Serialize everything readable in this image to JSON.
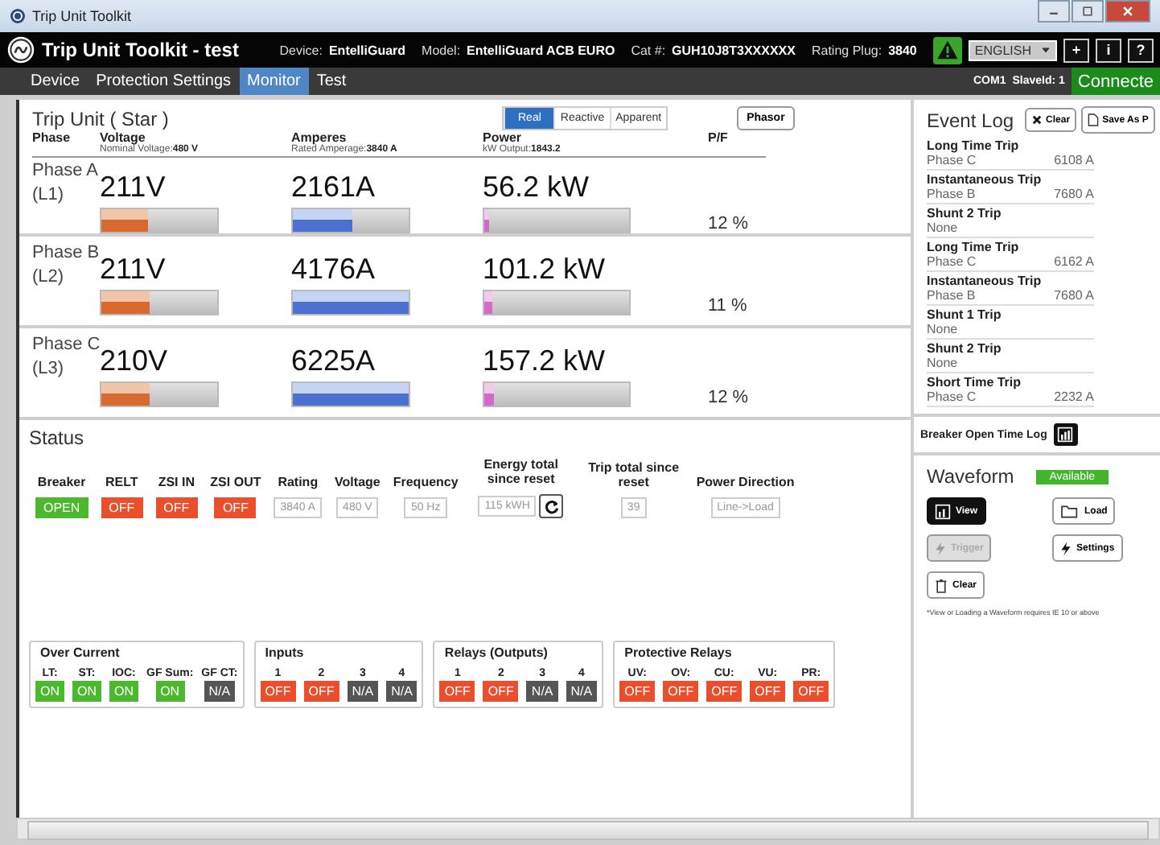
{
  "window": {
    "title": "Trip Unit Toolkit"
  },
  "header": {
    "app_title": "Trip Unit Toolkit -  test",
    "info": [
      {
        "label": "Device:",
        "value": "EntelliGuard"
      },
      {
        "label": "Model:",
        "value": "EntelliGuard ACB EURO"
      },
      {
        "label": "Cat #:",
        "value": "GUH10J8T3XXXXXX"
      },
      {
        "label": "Rating Plug:",
        "value": "3840"
      }
    ],
    "language": "ENGLISH",
    "buttons": [
      "+",
      "i",
      "?"
    ]
  },
  "nav": {
    "tabs": [
      {
        "label": "Device",
        "selected": false
      },
      {
        "label": "Protection Settings",
        "selected": false
      },
      {
        "label": "Monitor",
        "selected": true
      },
      {
        "label": "Test",
        "selected": false
      }
    ],
    "port": "COM1",
    "slave": "SlaveId: 1",
    "connection": "Connecte"
  },
  "trip_unit": {
    "title": "Trip Unit  ( Star )",
    "modes": [
      {
        "label": "Real",
        "selected": true
      },
      {
        "label": "Reactive",
        "selected": false
      },
      {
        "label": "Apparent",
        "selected": false
      }
    ],
    "phasor": "Phasor",
    "columns": [
      {
        "label": "Phase"
      },
      {
        "label": "Voltage",
        "sub_label": "Nominal Voltage:",
        "sub_value": "480  V"
      },
      {
        "label": "Amperes",
        "sub_label": "Rated Amperage:",
        "sub_value": "3840 A"
      },
      {
        "label": "Power",
        "sub_label": "kW Output:",
        "sub_value": "1843.2"
      },
      {
        "label": "P/F"
      }
    ],
    "phases": [
      {
        "name": "Phase A",
        "line": "(L1)",
        "voltage": {
          "reading": "211V",
          "level": 0.4
        },
        "amperes": {
          "reading": "2161A",
          "level": 0.52
        },
        "power": {
          "reading": "56.2 kW",
          "level": 0.03
        },
        "pf": "12 %"
      },
      {
        "name": "Phase B",
        "line": "(L2)",
        "voltage": {
          "reading": "211V",
          "level": 0.41
        },
        "amperes": {
          "reading": "4176A",
          "level": 1.0
        },
        "power": {
          "reading": "101.2 kW",
          "level": 0.05
        },
        "pf": "11 %"
      },
      {
        "name": "Phase C",
        "line": "(L3)",
        "voltage": {
          "reading": "210V",
          "level": 0.41
        },
        "amperes": {
          "reading": "6225A",
          "level": 1.0
        },
        "power": {
          "reading": "157.2 kW",
          "level": 0.07
        },
        "pf": "12 %"
      }
    ]
  },
  "status": {
    "title": "Status",
    "fields": [
      {
        "kind": "pill",
        "label": "Breaker",
        "value": "OPEN",
        "color": "#4cb82d"
      },
      {
        "kind": "pill",
        "label": "RELT",
        "value": "OFF",
        "color": "#e94f2d"
      },
      {
        "kind": "pill",
        "label": "ZSI IN",
        "value": "OFF",
        "color": "#e94f2d"
      },
      {
        "kind": "pill",
        "label": "ZSI OUT",
        "value": "OFF",
        "color": "#e94f2d"
      },
      {
        "kind": "box",
        "label": "Rating",
        "value": "3840 A"
      },
      {
        "kind": "box",
        "label": "Voltage",
        "value": "480 V"
      },
      {
        "kind": "box",
        "label": "Frequency",
        "value": "50 Hz"
      },
      {
        "kind": "reset",
        "label": "Energy total since reset",
        "value": "115 kWH"
      },
      {
        "kind": "box",
        "label": "Trip total since reset",
        "value": "39"
      },
      {
        "kind": "box",
        "label": "Power Direction",
        "value": "Line->Load"
      }
    ],
    "groups": [
      {
        "title": "Over Current",
        "items": [
          {
            "label": "LT:",
            "value": "ON",
            "color": "#4cb82d"
          },
          {
            "label": "ST:",
            "value": "ON",
            "color": "#4cb82d"
          },
          {
            "label": "IOC:",
            "value": "ON",
            "color": "#4cb82d"
          },
          {
            "label": "GF Sum:",
            "value": "ON",
            "color": "#4cb82d"
          },
          {
            "label": "GF CT:",
            "value": "N/A",
            "color": "#555555"
          }
        ]
      },
      {
        "title": "Inputs",
        "items": [
          {
            "label": "1",
            "value": "OFF",
            "color": "#e94f2d"
          },
          {
            "label": "2",
            "value": "OFF",
            "color": "#e94f2d"
          },
          {
            "label": "3",
            "value": "N/A",
            "color": "#555555"
          },
          {
            "label": "4",
            "value": "N/A",
            "color": "#555555"
          }
        ]
      },
      {
        "title": "Relays (Outputs)",
        "items": [
          {
            "label": "1",
            "value": "OFF",
            "color": "#e94f2d"
          },
          {
            "label": "2",
            "value": "OFF",
            "color": "#e94f2d"
          },
          {
            "label": "3",
            "value": "N/A",
            "color": "#555555"
          },
          {
            "label": "4",
            "value": "N/A",
            "color": "#555555"
          }
        ]
      },
      {
        "title": "Protective Relays",
        "items": [
          {
            "label": "UV:",
            "value": "OFF",
            "color": "#e94f2d"
          },
          {
            "label": "OV:",
            "value": "OFF",
            "color": "#e94f2d"
          },
          {
            "label": "CU:",
            "value": "OFF",
            "color": "#e94f2d"
          },
          {
            "label": "VU:",
            "value": "OFF",
            "color": "#e94f2d"
          },
          {
            "label": "PR:",
            "value": "OFF",
            "color": "#e94f2d"
          }
        ]
      }
    ]
  },
  "event_log": {
    "title": "Event Log",
    "clear": "Clear",
    "save": "Save As P",
    "events": [
      {
        "name": "Long Time Trip",
        "phase": "Phase C",
        "value": "6108 A"
      },
      {
        "name": "Instantaneous Trip",
        "phase": "Phase B",
        "value": "7680 A"
      },
      {
        "name": "Shunt 2 Trip",
        "phase": "None"
      },
      {
        "name": "Long Time Trip",
        "phase": "Phase C",
        "value": "6162 A"
      },
      {
        "name": "Instantaneous Trip",
        "phase": "Phase B",
        "value": "7680 A"
      },
      {
        "name": "Shunt 1 Trip",
        "phase": "None"
      },
      {
        "name": "Shunt 2 Trip",
        "phase": "None"
      },
      {
        "name": "Short Time Trip",
        "phase": "Phase C",
        "value": "2232 A"
      }
    ]
  },
  "breaker_log": {
    "title": "Breaker Open Time Log"
  },
  "waveform": {
    "title": "Waveform",
    "badge": "Available",
    "buttons": [
      {
        "kind": "view",
        "label": "View",
        "disabled": false
      },
      {
        "kind": "load",
        "label": "Load",
        "disabled": false
      },
      {
        "kind": "trigger",
        "label": "Trigger",
        "disabled": true
      },
      {
        "kind": "settings",
        "label": "Settings",
        "disabled": false
      },
      {
        "kind": "clear",
        "label": "Clear",
        "disabled": false
      }
    ],
    "note": "*View or Loading a Waveform requires IE 10 or above"
  }
}
